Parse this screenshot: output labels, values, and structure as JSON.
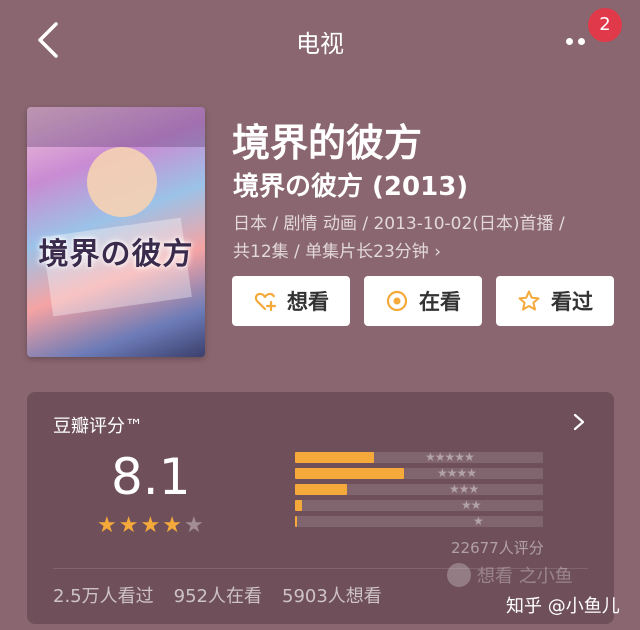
{
  "header": {
    "title": "电视",
    "notification_count": "2"
  },
  "poster": {
    "overlay_text": "境界の彼方"
  },
  "show": {
    "title": "境界的彼方",
    "original_title": "境界の彼方 (2013)",
    "meta_line1": "日本 / 剧情 动画 / 2013-10-02(日本)首播 /",
    "meta_line2": "共12集 / 单集片长23分钟 ›"
  },
  "actions": {
    "want_label": "想看",
    "watching_label": "在看",
    "watched_label": "看过"
  },
  "rating": {
    "label": "豆瓣评分™",
    "score": "8.1",
    "stars_filled": 4,
    "stars_total": 5,
    "distribution": [
      {
        "stars": 5,
        "fraction": 0.32
      },
      {
        "stars": 4,
        "fraction": 0.44
      },
      {
        "stars": 3,
        "fraction": 0.21
      },
      {
        "stars": 2,
        "fraction": 0.03
      },
      {
        "stars": 1,
        "fraction": 0.01
      }
    ],
    "count_text": "22677人评分",
    "watermark_text": "想看 之小鱼"
  },
  "stats": {
    "watched": "2.5万人看过",
    "watching": "952人在看",
    "want": "5903人想看"
  },
  "footer": {
    "zhihu_text": "知乎 @小鱼儿"
  },
  "colors": {
    "background": "#8a6670",
    "accent": "#f4a93a",
    "badge": "#e0394a"
  }
}
